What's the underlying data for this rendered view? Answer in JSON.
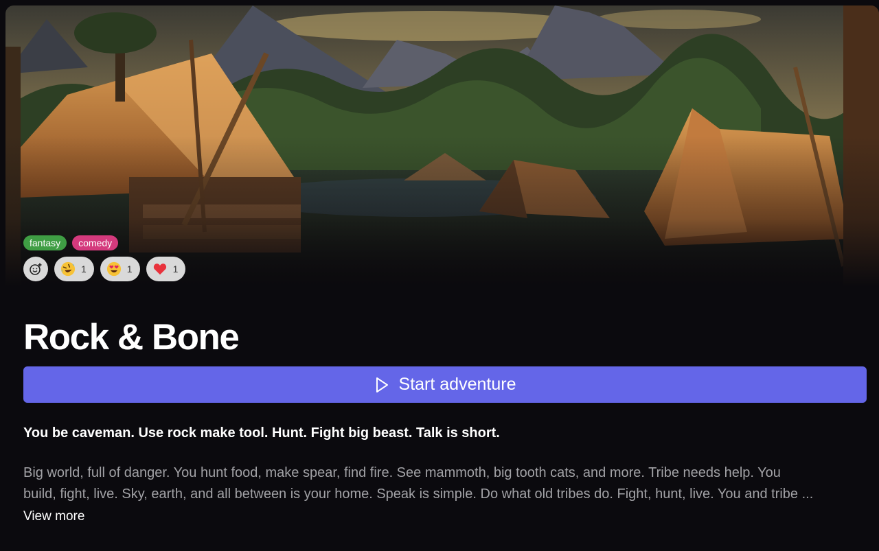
{
  "hero": {
    "image_alt": "caveman village"
  },
  "tags": [
    {
      "label": "fantasy",
      "color": "#3f9e44"
    },
    {
      "label": "comedy",
      "color": "#d43a7d"
    }
  ],
  "reactions": {
    "add_icon": "add-reaction-icon",
    "items": [
      {
        "emoji": "rolling-on-floor-laughing",
        "count": "1"
      },
      {
        "emoji": "heart-eyes",
        "count": "1"
      },
      {
        "emoji": "red-heart",
        "count": "1"
      }
    ]
  },
  "title": "Rock & Bone",
  "start_button": {
    "label": "Start adventure",
    "icon": "play-icon",
    "color": "#6466e8"
  },
  "tagline": "You be caveman. Use rock make tool. Hunt. Fight big beast. Talk is short.",
  "description": {
    "line1": "Big world, full of danger. You hunt food, make spear, find fire. See mammoth, big tooth cats, and more. Tribe needs help. You",
    "line2": "build, fight, live. Sky, earth, and all between is your home. Speak is simple. Do what old tribes do. Fight, hunt, live. You and tribe ..."
  },
  "view_more": "View more"
}
